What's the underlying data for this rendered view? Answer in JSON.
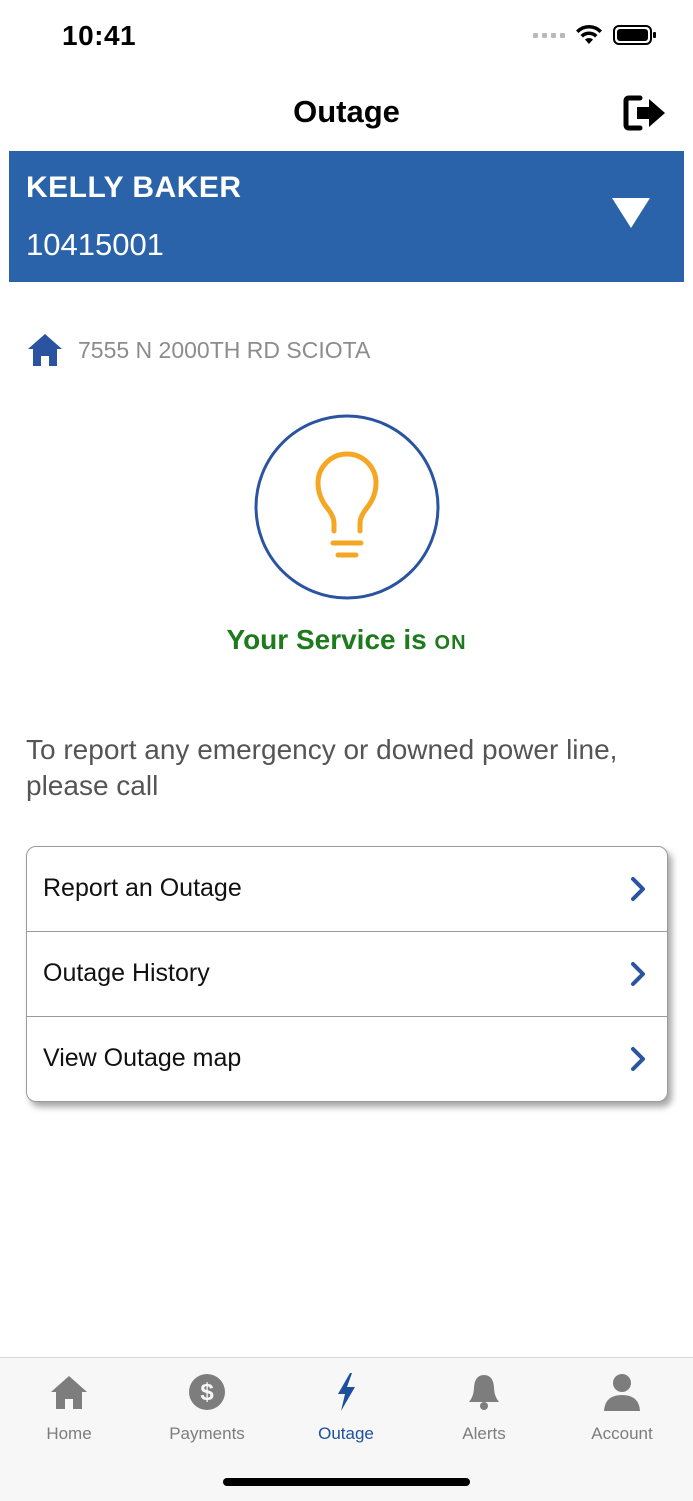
{
  "status_bar": {
    "time": "10:41"
  },
  "header": {
    "title": "Outage",
    "logout_icon": "logout-icon"
  },
  "account": {
    "name": "KELLY BAKER",
    "number": "10415001",
    "expand_icon": "caret-down-icon"
  },
  "address": {
    "icon": "home-icon",
    "text": "7555 N 2000TH RD SCIOTA"
  },
  "service": {
    "icon": "lightbulb-icon",
    "status_text": "Your Service is",
    "status_value": "ON",
    "status_color": "#1d7a1d",
    "bulb_color": "#f5a623",
    "circle_color": "#2a54a0"
  },
  "emergency": {
    "text": "To report any emergency or downed power line, please call"
  },
  "menu": {
    "items": [
      {
        "label": "Report an Outage"
      },
      {
        "label": "Outage History"
      },
      {
        "label": "View Outage map"
      }
    ],
    "chevron_color": "#2a54a0"
  },
  "tabs": [
    {
      "label": "Home",
      "icon": "home-icon",
      "active": false
    },
    {
      "label": "Payments",
      "icon": "dollar-icon",
      "active": false
    },
    {
      "label": "Outage",
      "icon": "lightning-icon",
      "active": true
    },
    {
      "label": "Alerts",
      "icon": "bell-icon",
      "active": false
    },
    {
      "label": "Account",
      "icon": "person-icon",
      "active": false
    }
  ],
  "colors": {
    "brand": "#2a63aa",
    "active_tab": "#1e4f9c",
    "inactive_tab": "#7d7d7d"
  }
}
